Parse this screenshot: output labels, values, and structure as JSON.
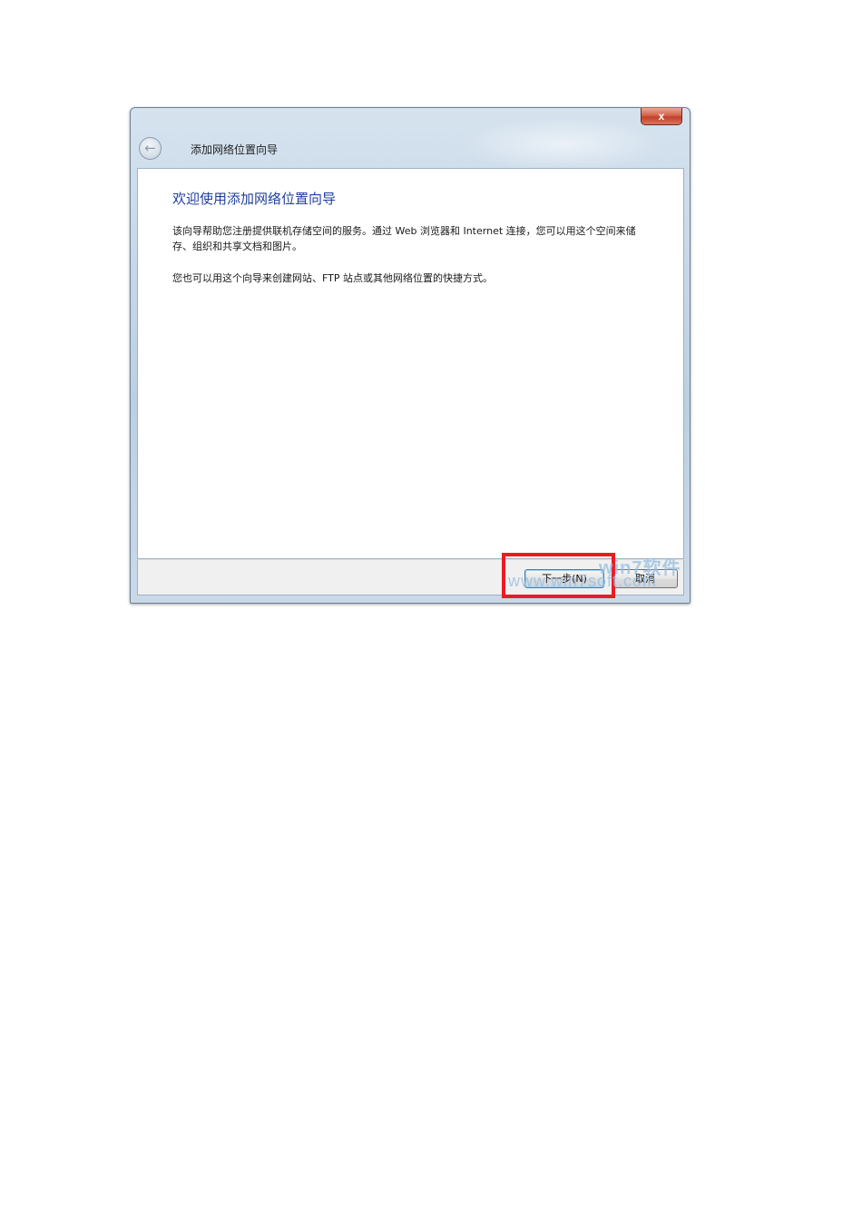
{
  "window": {
    "close_label": "x",
    "title": "添加网络位置向导"
  },
  "content": {
    "heading": "欢迎使用添加网络位置向导",
    "paragraph1": "该向导帮助您注册提供联机存储空间的服务。通过 Web 浏览器和 Internet 连接，您可以用这个空间来储存、组织和共享文档和图片。",
    "paragraph2": "您也可以用这个向导来创建网站、FTP 站点或其他网络位置的快捷方式。"
  },
  "buttons": {
    "next": "下一步(N)",
    "cancel": "取消"
  },
  "watermark": {
    "top": "win7软件",
    "bottom": "www.win7soft.com"
  },
  "colors": {
    "heading": "#1f3f9e",
    "highlight": "#ee1b24",
    "close_button": "#c2402a"
  }
}
